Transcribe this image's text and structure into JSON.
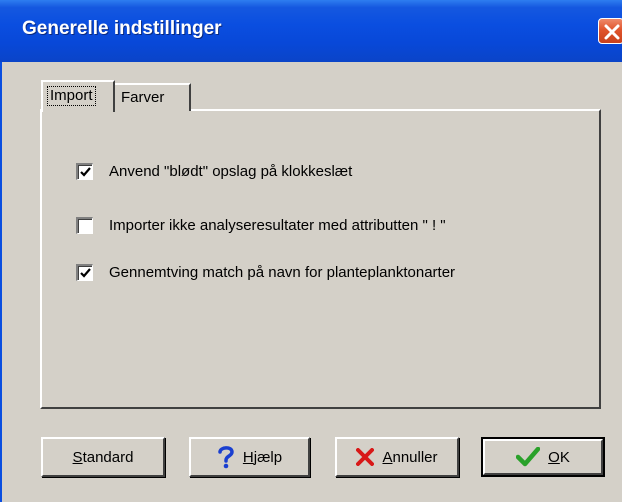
{
  "window": {
    "title": "Generelle indstillinger"
  },
  "tabs": [
    {
      "label": "Import",
      "selected": true
    },
    {
      "label": "Farver",
      "selected": false
    }
  ],
  "options": [
    {
      "label": "Anvend \"blødt\" opslag på klokkeslæt",
      "checked": true
    },
    {
      "label": "Importer ikke analyseresultater med attributten \" ! \"",
      "checked": false
    },
    {
      "label": "Gennemtving match på navn for planteplanktonarter",
      "checked": true
    }
  ],
  "buttons": {
    "standard_label": "Standard",
    "help_label": "Hjælp",
    "cancel_label": "Annuller",
    "ok_label": "OK"
  },
  "icons": {
    "close": "close-icon",
    "help": "question-mark-icon",
    "cancel": "red-x-icon",
    "ok": "green-check-icon"
  },
  "colors": {
    "titlebar": "#0a4ee0",
    "face": "#d4d0c8",
    "close_button": "#e0542c",
    "help_icon": "#1a3fd0",
    "cancel_icon": "#d81818",
    "ok_icon": "#2aa12a"
  }
}
